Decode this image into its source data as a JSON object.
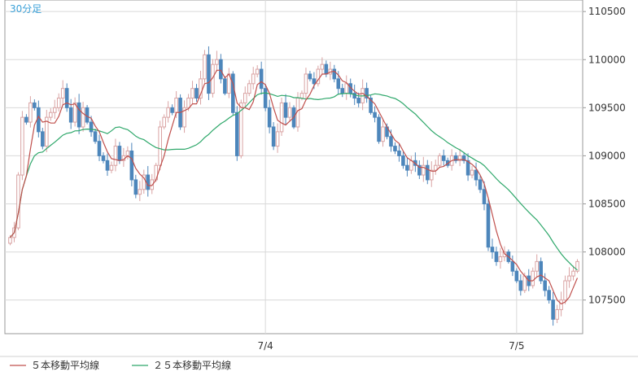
{
  "chart_data": {
    "type": "candlestick",
    "timeframe_label": "30分足",
    "x_tick_labels": [
      {
        "label": "7/4",
        "index": 63
      },
      {
        "label": "7/5",
        "index": 125
      }
    ],
    "y_ticks": [
      107500,
      108000,
      108500,
      109000,
      109500,
      110000,
      110500
    ],
    "ylim": [
      107150,
      110620
    ],
    "grid": true,
    "colors": {
      "up": "#d9a3a3",
      "down": "#4d86bb",
      "ma5": "#c0504d",
      "ma25": "#2fa86b",
      "label": "#3aa0d8",
      "grid": "#d9d9d9"
    },
    "legend": [
      {
        "label": "５本移動平均線",
        "color": "#c0504d"
      },
      {
        "label": "２５本移動平均線",
        "color": "#2fa86b"
      }
    ],
    "closes": [
      108150,
      108250,
      108800,
      109400,
      109350,
      109550,
      109500,
      109250,
      109100,
      109400,
      109450,
      109500,
      109600,
      109700,
      109500,
      109350,
      109550,
      109300,
      109500,
      109350,
      109250,
      109150,
      109000,
      108950,
      108850,
      108900,
      109100,
      108950,
      109000,
      109050,
      108750,
      108600,
      108650,
      108800,
      108650,
      108750,
      108900,
      109300,
      109400,
      109500,
      109450,
      109600,
      109300,
      109500,
      109600,
      109700,
      109600,
      109800,
      110050,
      109650,
      109950,
      110000,
      109800,
      109650,
      109850,
      109450,
      109000,
      109550,
      109650,
      109750,
      109850,
      109900,
      109700,
      109500,
      109300,
      109100,
      109250,
      109550,
      109400,
      109500,
      109300,
      109600,
      109650,
      109850,
      109800,
      109750,
      109900,
      109950,
      109850,
      109900,
      109800,
      109700,
      109650,
      109750,
      109650,
      109600,
      109550,
      109700,
      109600,
      109450,
      109400,
      109150,
      109300,
      109200,
      109100,
      109050,
      109000,
      108900,
      108850,
      108950,
      108900,
      108800,
      108900,
      108750,
      108850,
      108900,
      109000,
      108950,
      108900,
      109000,
      108950,
      109000,
      108950,
      108800,
      108850,
      108750,
      108650,
      108500,
      108050,
      108000,
      107900,
      107950,
      108000,
      107900,
      107800,
      107700,
      107600,
      107750,
      107650,
      107800,
      107900,
      107700,
      107600,
      107500,
      107300,
      107400,
      107500,
      107700,
      107750,
      107800,
      107900
    ]
  }
}
